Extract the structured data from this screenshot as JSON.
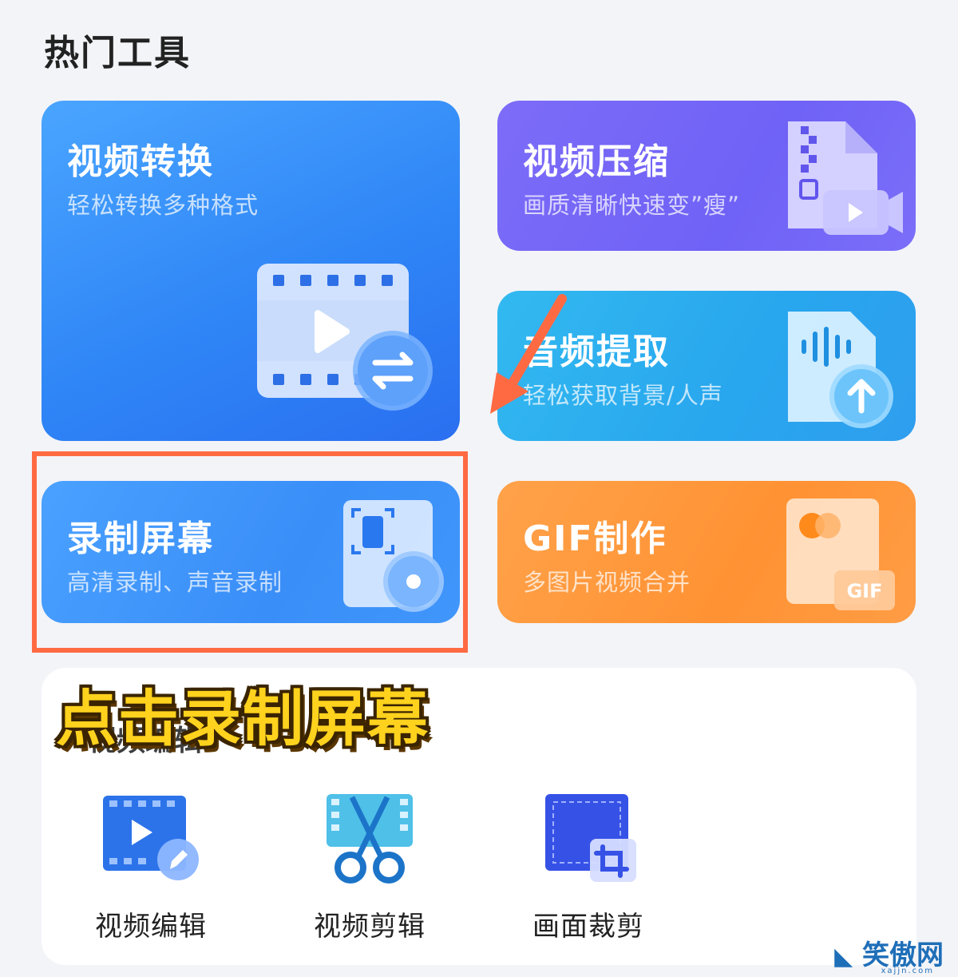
{
  "section": {
    "title": "热门工具"
  },
  "cards": {
    "convert": {
      "title": "视频转换",
      "subtitle": "轻松转换多种格式"
    },
    "compress": {
      "title": "视频压缩",
      "subtitle": "画质清晰快速变”瘦”"
    },
    "audio": {
      "title": "音频提取",
      "subtitle": "轻松获取背景/人声"
    },
    "record": {
      "title": "录制屏幕",
      "subtitle": "高清录制、声音录制"
    },
    "gif": {
      "title": "GIF制作",
      "subtitle": "多图片视频合并",
      "badge": "GIF"
    }
  },
  "annotation": {
    "text": "点击录制屏幕",
    "highlight_color": "#ff6a43"
  },
  "bottom": {
    "obscured_heading": "视频编辑",
    "tools": [
      {
        "label": "视频编辑",
        "icon": "video-edit-icon"
      },
      {
        "label": "视频剪辑",
        "icon": "scissors-film-icon"
      },
      {
        "label": "画面裁剪",
        "icon": "crop-icon"
      }
    ]
  },
  "watermark": {
    "text": "笑傲网",
    "sub": "xajjn.com"
  },
  "colors": {
    "convert": "#3a8ef8",
    "compress": "#7468f7",
    "audio": "#2aa8ef",
    "record": "#4096fb",
    "gif": "#ff9539"
  }
}
